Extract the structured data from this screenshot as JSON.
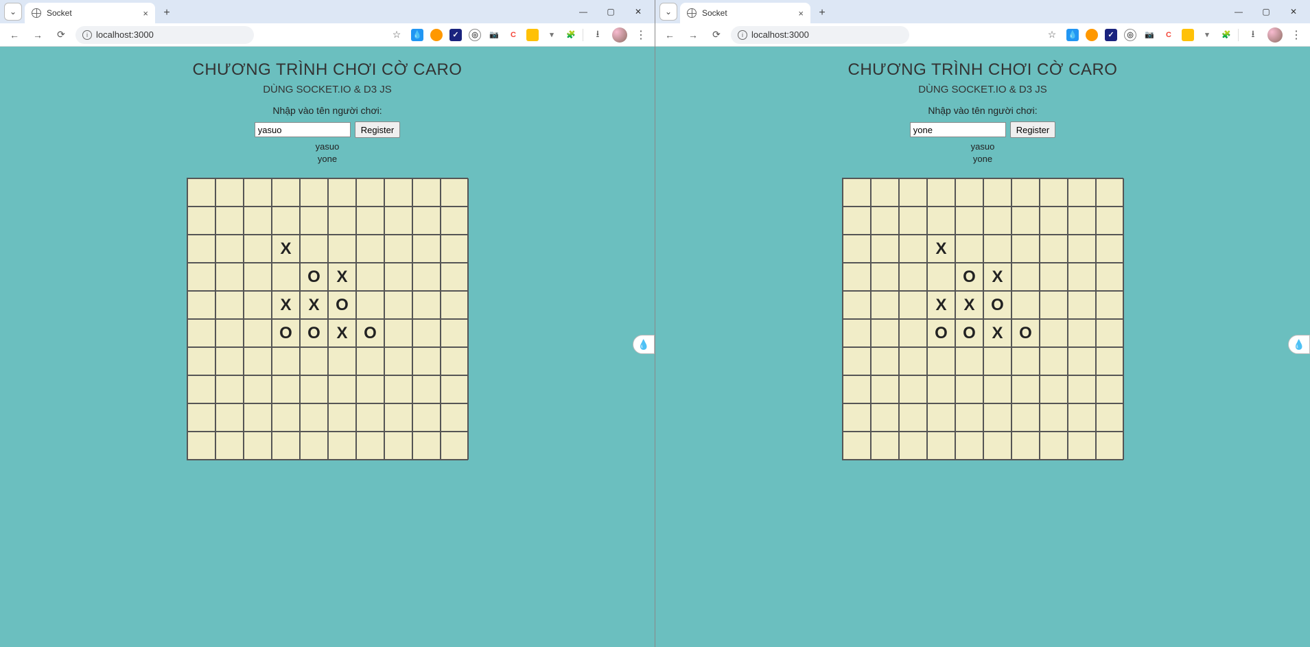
{
  "windows": [
    {
      "tab_title": "Socket",
      "url": "localhost:3000",
      "title": "CHƯƠNG TRÌNH CHƠI CỜ CARO",
      "subtitle": "DÙNG SOCKET.IO & D3 JS",
      "prompt": "Nhập vào tên người chơi:",
      "input_value": "yasuo",
      "register_label": "Register",
      "players": [
        "yasuo",
        "yone"
      ],
      "board": {
        "cols": 10,
        "rows": 10,
        "marks": [
          {
            "r": 2,
            "c": 3,
            "v": "X"
          },
          {
            "r": 3,
            "c": 4,
            "v": "O"
          },
          {
            "r": 3,
            "c": 5,
            "v": "X"
          },
          {
            "r": 4,
            "c": 3,
            "v": "X"
          },
          {
            "r": 4,
            "c": 4,
            "v": "X"
          },
          {
            "r": 4,
            "c": 5,
            "v": "O"
          },
          {
            "r": 5,
            "c": 3,
            "v": "O"
          },
          {
            "r": 5,
            "c": 4,
            "v": "O"
          },
          {
            "r": 5,
            "c": 5,
            "v": "X"
          },
          {
            "r": 5,
            "c": 6,
            "v": "O"
          }
        ]
      }
    },
    {
      "tab_title": "Socket",
      "url": "localhost:3000",
      "title": "CHƯƠNG TRÌNH CHƠI CỜ CARO",
      "subtitle": "DÙNG SOCKET.IO & D3 JS",
      "prompt": "Nhập vào tên người chơi:",
      "input_value": "yone",
      "register_label": "Register",
      "players": [
        "yasuo",
        "yone"
      ],
      "board": {
        "cols": 10,
        "rows": 10,
        "marks": [
          {
            "r": 2,
            "c": 3,
            "v": "X"
          },
          {
            "r": 3,
            "c": 4,
            "v": "O"
          },
          {
            "r": 3,
            "c": 5,
            "v": "X"
          },
          {
            "r": 4,
            "c": 3,
            "v": "X"
          },
          {
            "r": 4,
            "c": 4,
            "v": "X"
          },
          {
            "r": 4,
            "c": 5,
            "v": "O"
          },
          {
            "r": 5,
            "c": 3,
            "v": "O"
          },
          {
            "r": 5,
            "c": 4,
            "v": "O"
          },
          {
            "r": 5,
            "c": 5,
            "v": "X"
          },
          {
            "r": 5,
            "c": 6,
            "v": "O"
          }
        ]
      }
    }
  ],
  "colors": {
    "page_bg": "#6bbfbf",
    "board_bg": "#f1edc8",
    "grid_line": "#555"
  }
}
